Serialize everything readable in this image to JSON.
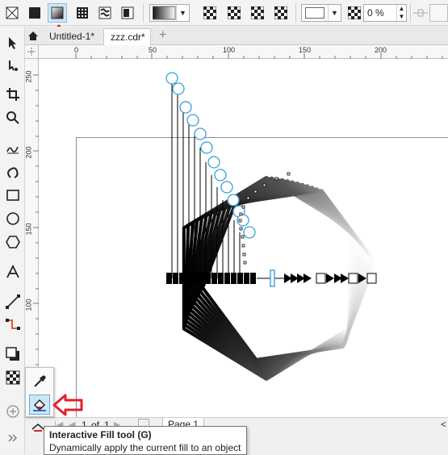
{
  "propbar": {
    "outline_width_value": "0 %",
    "tools": [
      "no-fill",
      "uniform-fill",
      "fountain-fill",
      "vector-pattern-fill",
      "bitmap-pattern-fill",
      "two-color-pattern-fill"
    ]
  },
  "tabs": [
    {
      "label": "Untitled-1*",
      "active": false
    },
    {
      "label": "zzz.cdr*",
      "active": true
    }
  ],
  "ruler": {
    "h_ticks": [
      "0",
      "50",
      "100",
      "150",
      "200"
    ],
    "v_ticks": [
      "250",
      "200",
      "150",
      "100"
    ]
  },
  "pagenav": {
    "current": "1",
    "of_label": "of",
    "total": "1",
    "page_tab": "Page 1"
  },
  "tooltip": {
    "title": "Interactive Fill tool (G)",
    "description": "Dynamically apply the current fill to an object"
  },
  "colors": {
    "highlight_red": "#e0222b",
    "node_blue": "#3aa0d8",
    "selection_blue": "#cfe6f6"
  }
}
